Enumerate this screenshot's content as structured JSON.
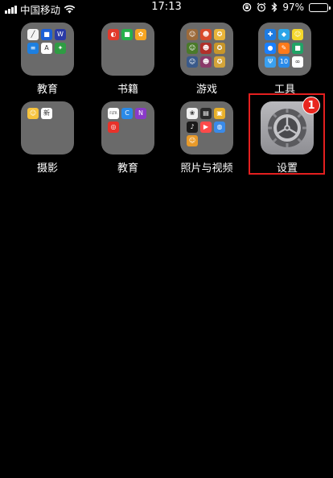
{
  "status_bar": {
    "carrier": "中国移动",
    "time": "17:13",
    "battery": "97%",
    "battery_fraction": 0.97
  },
  "apps": [
    {
      "label": "教育",
      "minis": [
        {
          "color": "#f4f4f4",
          "glyph": "╱"
        },
        {
          "color": "#1c5fd6",
          "glyph": "■"
        },
        {
          "color": "#2a3aa6",
          "glyph": "W"
        },
        {
          "color": "#1d7fe0",
          "glyph": "≡"
        },
        {
          "color": "#ffffff",
          "glyph": "A"
        },
        {
          "color": "#2f9c43",
          "glyph": "✦"
        }
      ]
    },
    {
      "label": "书籍",
      "minis": [
        {
          "color": "#e23a2c",
          "glyph": "◐"
        },
        {
          "color": "#27b04b",
          "glyph": "■"
        },
        {
          "color": "#f5a522",
          "glyph": "✿"
        }
      ]
    },
    {
      "label": "游戏",
      "minis": [
        {
          "color": "#9c6a3a",
          "glyph": "☺"
        },
        {
          "color": "#d94a2a",
          "glyph": "☻"
        },
        {
          "color": "#e8b43a",
          "glyph": "✪"
        },
        {
          "color": "#4a7a2a",
          "glyph": "☺"
        },
        {
          "color": "#b0302a",
          "glyph": "☻"
        },
        {
          "color": "#c8962a",
          "glyph": "✪"
        },
        {
          "color": "#3a5a8a",
          "glyph": "☺"
        },
        {
          "color": "#8a3a6a",
          "glyph": "☻"
        },
        {
          "color": "#d4a43a",
          "glyph": "✪"
        }
      ]
    },
    {
      "label": "工具",
      "minis": [
        {
          "color": "#1e7be0",
          "glyph": "✚"
        },
        {
          "color": "#2aa4e8",
          "glyph": "◆"
        },
        {
          "color": "#f5d82a",
          "glyph": "☺"
        },
        {
          "color": "#1a80ff",
          "glyph": "●"
        },
        {
          "color": "#ff7a1a",
          "glyph": "✎"
        },
        {
          "color": "#21a366",
          "glyph": "■"
        },
        {
          "color": "#3aa0f0",
          "glyph": "Ψ"
        },
        {
          "color": "#2a8ae8",
          "glyph": "10"
        },
        {
          "color": "#ffffff",
          "glyph": "∞"
        }
      ]
    },
    {
      "label": "摄影",
      "minis": [
        {
          "color": "#f7c33c",
          "glyph": "☺"
        },
        {
          "color": "#ffffff",
          "glyph": "新"
        }
      ]
    },
    {
      "label": "教育",
      "minis": [
        {
          "color": "#ffffff",
          "glyph": "FLTR"
        },
        {
          "color": "#2a8ae8",
          "glyph": "C"
        },
        {
          "color": "#8a3ac8",
          "glyph": "N"
        },
        {
          "color": "#e8322a",
          "glyph": "◎"
        }
      ]
    },
    {
      "label": "照片与视频",
      "minis": [
        {
          "color": "#f0f0f0",
          "glyph": "❀"
        },
        {
          "color": "#2a2a2a",
          "glyph": "▤"
        },
        {
          "color": "#e8b02a",
          "glyph": "▣"
        },
        {
          "color": "#1a1a1a",
          "glyph": "♪"
        },
        {
          "color": "#ff4a4a",
          "glyph": "▶"
        },
        {
          "color": "#3a8ae8",
          "glyph": "◍"
        },
        {
          "color": "#e89a2a",
          "glyph": "☺"
        }
      ]
    }
  ],
  "settings": {
    "label": "设置",
    "badge": "1",
    "icon_colors": {
      "bg": "#9a9a9f",
      "gear": "#555559"
    }
  },
  "highlight_color": "#e41f1f"
}
